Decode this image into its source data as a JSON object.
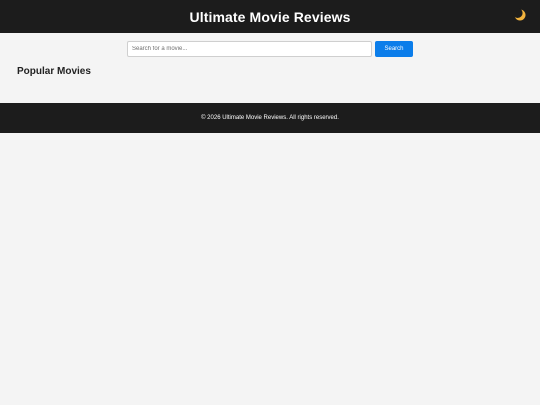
{
  "header": {
    "title": "Ultimate Movie Reviews",
    "theme_icon": "crescent-moon-icon"
  },
  "search": {
    "placeholder": "Search for a movie...",
    "value": "",
    "button_label": "Search"
  },
  "main": {
    "section_title": "Popular Movies"
  },
  "footer": {
    "text": "© 2026 Ultimate Movie Reviews. All rights reserved."
  },
  "colors": {
    "header_bg": "#1c1c1c",
    "page_bg": "#f4f4f4",
    "accent": "#0b7dea",
    "moon": "#f2b33d"
  }
}
